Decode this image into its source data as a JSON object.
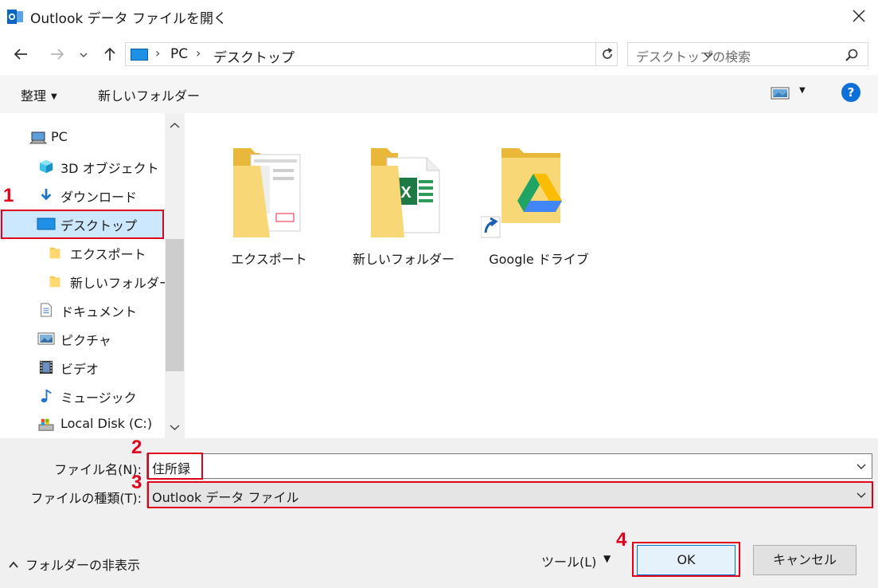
{
  "window": {
    "title": "Outlook データ ファイルを開く"
  },
  "address": {
    "crumbs": [
      "PC",
      "デスクトップ"
    ],
    "search_placeholder": "デスクトップの検索"
  },
  "toolbar": {
    "organize": "整理",
    "new_folder": "新しいフォルダー"
  },
  "nav_pane": {
    "items": [
      {
        "label": "PC",
        "icon": "pc-icon"
      },
      {
        "label": "3D オブジェクト",
        "icon": "cube-3d-icon"
      },
      {
        "label": "ダウンロード",
        "icon": "download-arrow-icon"
      },
      {
        "label": "デスクトップ",
        "icon": "desktop-icon",
        "selected": true
      },
      {
        "label": "エクスポート",
        "icon": "folder-icon"
      },
      {
        "label": "新しいフォルダー",
        "icon": "folder-icon"
      },
      {
        "label": "ドキュメント",
        "icon": "document-icon"
      },
      {
        "label": "ピクチャ",
        "icon": "pictures-icon"
      },
      {
        "label": "ビデオ",
        "icon": "video-icon"
      },
      {
        "label": "ミュージック",
        "icon": "music-note-icon"
      },
      {
        "label": "Local Disk (C:)",
        "icon": "local-disk-icon"
      }
    ]
  },
  "files": [
    {
      "label": "エクスポート",
      "icon": "folder-with-screenshot-icon"
    },
    {
      "label": "新しいフォルダー",
      "icon": "folder-with-excel-icon"
    },
    {
      "label": "Google ドライブ",
      "icon": "google-drive-shortcut-icon"
    }
  ],
  "form": {
    "filename_label": "ファイル名(N):",
    "filename_value": "住所録",
    "filetype_label": "ファイルの種類(T):",
    "filetype_value": "Outlook データ ファイル"
  },
  "footer": {
    "hide_folders": "フォルダーの非表示",
    "tools": "ツール(L)",
    "ok": "OK",
    "cancel": "キャンセル"
  },
  "annotations": [
    "1",
    "2",
    "3",
    "4"
  ],
  "colors": {
    "highlight": "#e0001b",
    "selection": "#cce8ff",
    "accent": "#0078d7"
  }
}
